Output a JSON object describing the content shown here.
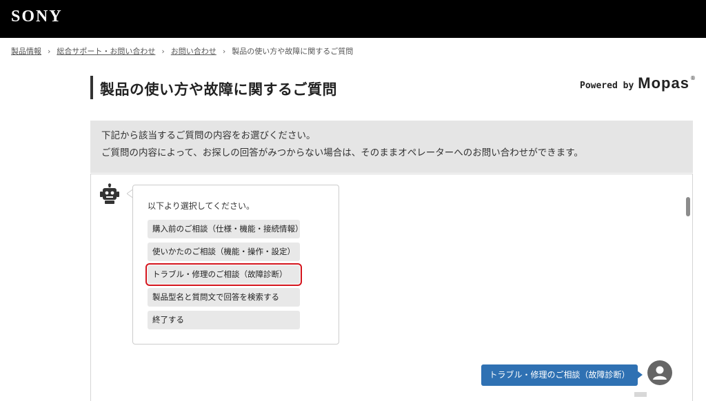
{
  "header": {
    "brand": "SONY"
  },
  "breadcrumb": {
    "items": [
      "製品情報",
      "総合サポート・お問い合わせ",
      "お問い合わせ"
    ],
    "current": "製品の使い方や故障に関するご質問",
    "separator": "›"
  },
  "page": {
    "title": "製品の使い方や故障に関するご質問",
    "powered_by": "Powered by",
    "powered_brand": "Mopas",
    "powered_mark": "®"
  },
  "notice": {
    "line1": "下記から該当するご質問の内容をお選びください。",
    "line2": "ご質問の内容によって、お探しの回答がみつからない場合は、そのままオペレーターへのお問い合わせができます。"
  },
  "chat": {
    "bot_prompt": "以下より選択してください。",
    "options": [
      "購入前のご相談（仕様・機能・接続情報）",
      "使いかたのご相談（機能・操作・設定）",
      "トラブル・修理のご相談（故障診断）",
      "製品型名と質問文で回答を検索する",
      "終了する"
    ],
    "selected_index": 2,
    "user_message": "トラブル・修理のご相談（故障診断）"
  },
  "colors": {
    "header_bg": "#000000",
    "notice_bg": "#e5e5e5",
    "option_bg": "#e8e8e8",
    "selection_outline": "#d4141c",
    "user_bubble": "#2f71b3"
  },
  "icons": {
    "bot": "robot-icon",
    "user": "user-avatar-icon",
    "separator": "chevron-right-icon"
  }
}
